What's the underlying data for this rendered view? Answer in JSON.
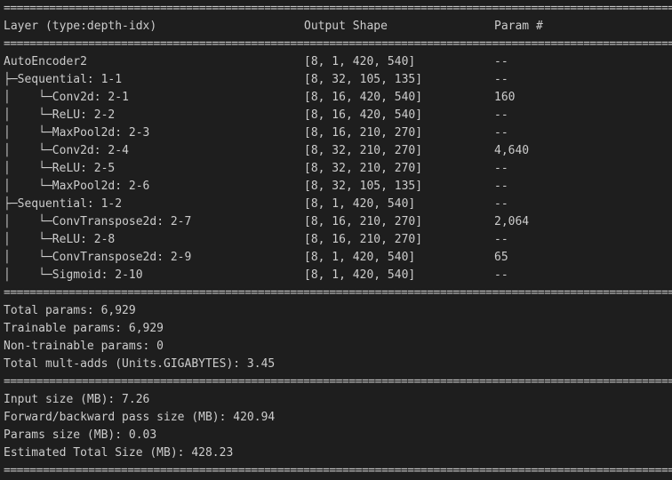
{
  "separator": "==============================================================================================================",
  "header": {
    "col_layer": "Layer (type:depth-idx)",
    "col_output": "Output Shape",
    "col_params": "Param #"
  },
  "rows": [
    {
      "prefix": "",
      "name": "AutoEncoder2",
      "shape": "[8, 1, 420, 540]",
      "params": "--"
    },
    {
      "prefix": "├─",
      "name": "Sequential: 1-1",
      "shape": "[8, 32, 105, 135]",
      "params": "--"
    },
    {
      "prefix": "│    └─",
      "name": "Conv2d: 2-1",
      "shape": "[8, 16, 420, 540]",
      "params": "160"
    },
    {
      "prefix": "│    └─",
      "name": "ReLU: 2-2",
      "shape": "[8, 16, 420, 540]",
      "params": "--"
    },
    {
      "prefix": "│    └─",
      "name": "MaxPool2d: 2-3",
      "shape": "[8, 16, 210, 270]",
      "params": "--"
    },
    {
      "prefix": "│    └─",
      "name": "Conv2d: 2-4",
      "shape": "[8, 32, 210, 270]",
      "params": "4,640"
    },
    {
      "prefix": "│    └─",
      "name": "ReLU: 2-5",
      "shape": "[8, 32, 210, 270]",
      "params": "--"
    },
    {
      "prefix": "│    └─",
      "name": "MaxPool2d: 2-6",
      "shape": "[8, 32, 105, 135]",
      "params": "--"
    },
    {
      "prefix": "├─",
      "name": "Sequential: 1-2",
      "shape": "[8, 1, 420, 540]",
      "params": "--"
    },
    {
      "prefix": "│    └─",
      "name": "ConvTranspose2d: 2-7",
      "shape": "[8, 16, 210, 270]",
      "params": "2,064"
    },
    {
      "prefix": "│    └─",
      "name": "ReLU: 2-8",
      "shape": "[8, 16, 210, 270]",
      "params": "--"
    },
    {
      "prefix": "│    └─",
      "name": "ConvTranspose2d: 2-9",
      "shape": "[8, 1, 420, 540]",
      "params": "65"
    },
    {
      "prefix": "│    └─",
      "name": "Sigmoid: 2-10",
      "shape": "[8, 1, 420, 540]",
      "params": "--"
    }
  ],
  "summary": {
    "total_params": "Total params: 6,929",
    "trainable_params": "Trainable params: 6,929",
    "non_trainable_params": "Non-trainable params: 0",
    "total_mult_adds": "Total mult-adds (Units.GIGABYTES): 3.45"
  },
  "sizes": {
    "input_size": "Input size (MB): 7.26",
    "forward_backward": "Forward/backward pass size (MB): 420.94",
    "params_size": "Params size (MB): 0.03",
    "estimated_total": "Estimated Total Size (MB): 428.23"
  }
}
